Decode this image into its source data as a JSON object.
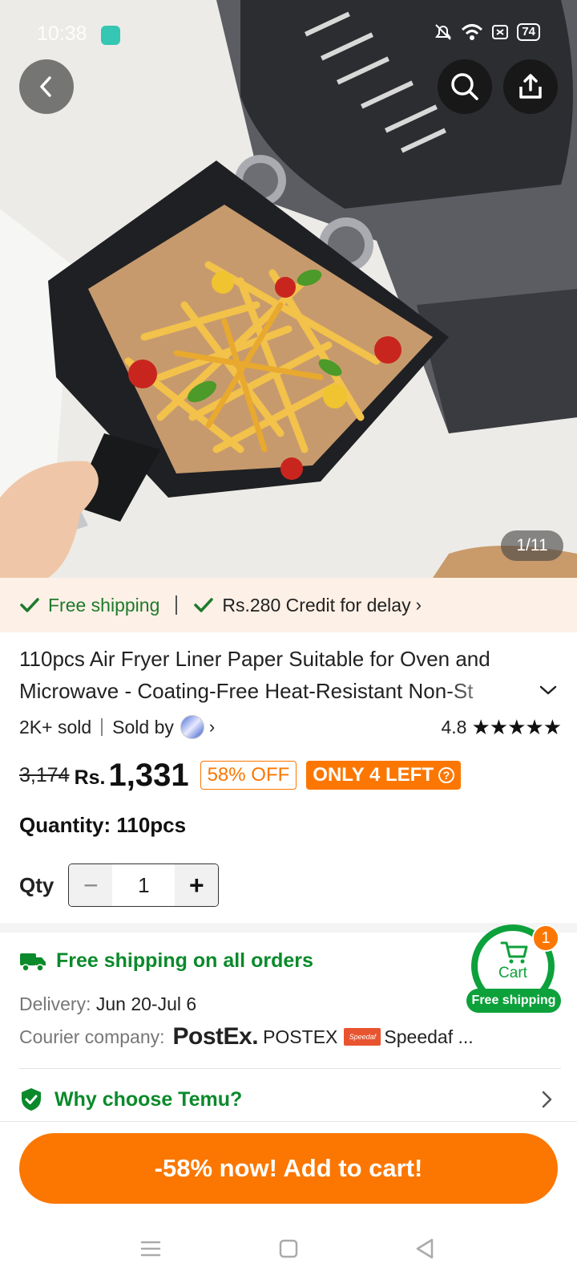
{
  "status_bar": {
    "time": "10:38",
    "battery": "74"
  },
  "gallery": {
    "counter": "1/11"
  },
  "banner": {
    "free_shipping": "Free shipping",
    "credit": "Rs.280 Credit for delay"
  },
  "product": {
    "title": "110pcs  Air Fryer Liner Paper Suitable for Oven and Microwave - Coating-Free Heat-Resistant Non-St",
    "sold": "2K+ sold",
    "sold_by": "Sold by",
    "rating": "4.8",
    "stars": "★★★★★",
    "old_price": "3,174",
    "currency": "Rs.",
    "price": "1,331",
    "discount_badge": "58% OFF",
    "stock_badge": "ONLY 4 LEFT",
    "stock_help": "?",
    "quantity_label": "Quantity: 110pcs",
    "qty_label": "Qty",
    "qty_value": "1",
    "qty_minus": "−",
    "qty_plus": "+"
  },
  "shipping": {
    "title": "Free shipping on all orders",
    "delivery_key": "Delivery:",
    "delivery_value": "Jun 20-Jul 6",
    "courier_key": "Courier company:",
    "postex_logo": "PostEx.",
    "postex_name": "POSTEX",
    "speedaf_logo": "Speedaf",
    "speedaf_name": "Speedaf ..."
  },
  "cart_float": {
    "label": "Cart",
    "count": "1",
    "ship": "Free shipping"
  },
  "why": {
    "label": "Why choose Temu?"
  },
  "cta": {
    "label": "-58% now! Add to cart!"
  },
  "colors": {
    "accent": "#fb7701",
    "green": "#0b8a2b",
    "banner_bg": "#fdf0e6"
  },
  "icons": [
    "back-icon",
    "search-icon",
    "share-icon",
    "check-icon",
    "chevron-down-icon",
    "truck-icon",
    "cart-icon",
    "shield-check-icon",
    "chevron-right-icon",
    "menu-icon",
    "home-icon",
    "nav-back-icon"
  ]
}
